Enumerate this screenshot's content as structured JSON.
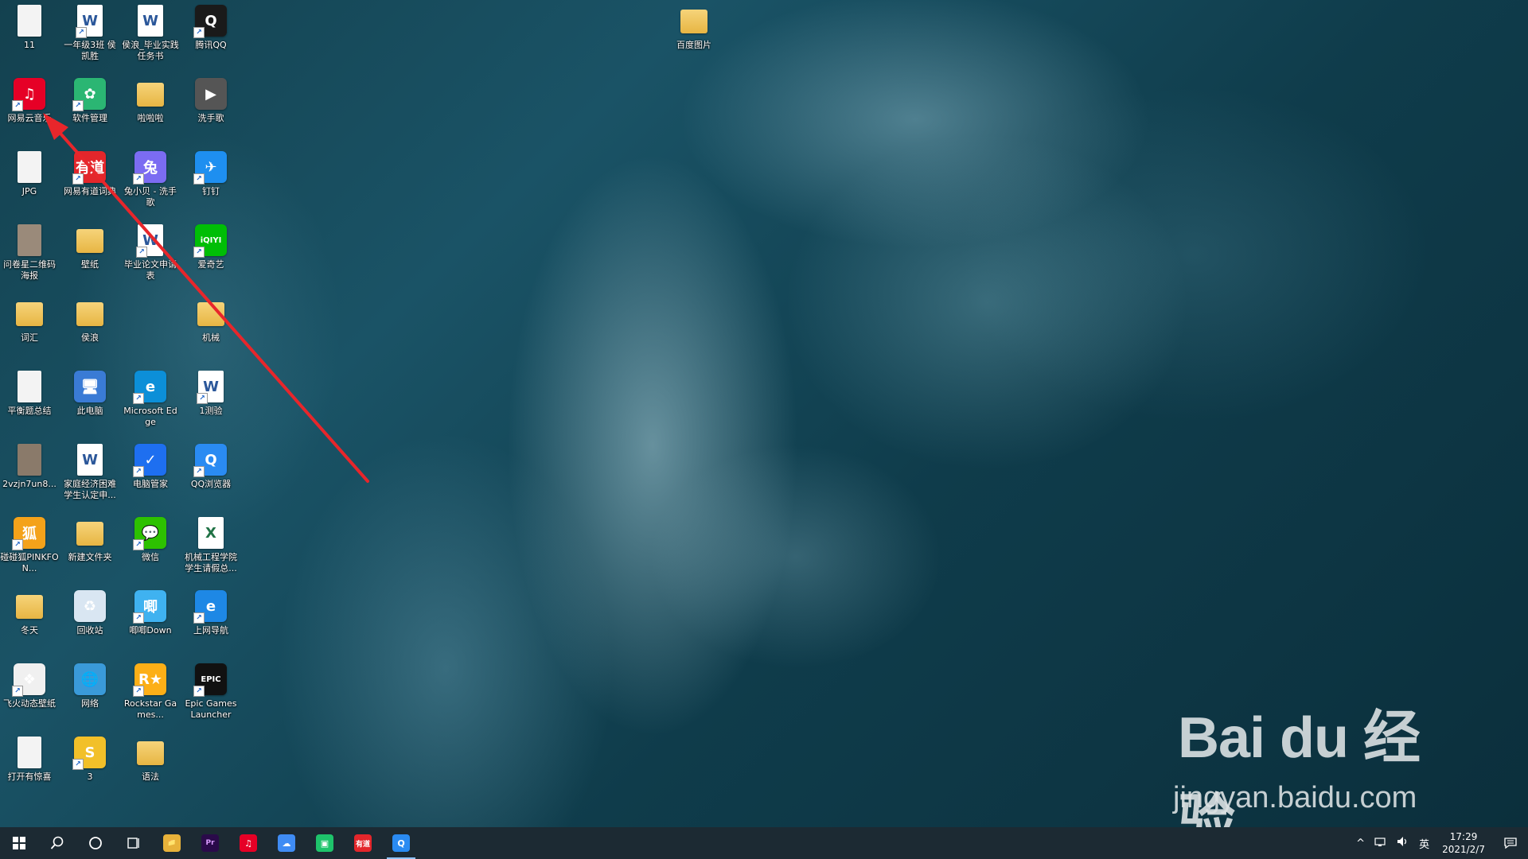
{
  "desktop": {
    "icons": [
      {
        "label": "11",
        "icon": "image-file-icon",
        "glyph": "",
        "color": "#f3f3f3",
        "shortcut": false
      },
      {
        "label": "一年级3班 侯凯胜",
        "icon": "word-doc-icon",
        "glyph": "W",
        "color": "#ffffff",
        "shortcut": true
      },
      {
        "label": "侯浪_毕业实践任务书",
        "icon": "word-doc-icon",
        "glyph": "W",
        "color": "#ffffff",
        "shortcut": false
      },
      {
        "label": "腾讯QQ",
        "icon": "qq-penguin-icon",
        "glyph": "Q",
        "color": "#1a1a1a",
        "shortcut": true
      },
      {
        "label": "网易云音乐",
        "icon": "netease-music-icon",
        "glyph": "♫",
        "color": "#e60026",
        "shortcut": true
      },
      {
        "label": "软件管理",
        "icon": "software-manager-icon",
        "glyph": "✿",
        "color": "#2bb673",
        "shortcut": true
      },
      {
        "label": "啦啦啦",
        "icon": "folder-icon",
        "glyph": "",
        "color": "#e7b543",
        "shortcut": false
      },
      {
        "label": "洗手歌",
        "icon": "video-file-icon",
        "glyph": "▶",
        "color": "#555555",
        "shortcut": false
      },
      {
        "label": "JPG",
        "icon": "image-file-icon",
        "glyph": "",
        "color": "#f3f3f3",
        "shortcut": false
      },
      {
        "label": "网易有道词典",
        "icon": "youdao-dict-icon",
        "glyph": "有道",
        "color": "#e3262b",
        "shortcut": true
      },
      {
        "label": "兔小贝 - 洗手歌",
        "icon": "tuxiaobei-icon",
        "glyph": "兔",
        "color": "#7b6cf2",
        "shortcut": true
      },
      {
        "label": "钉钉",
        "icon": "dingtalk-icon",
        "glyph": "✈",
        "color": "#1e8ff0",
        "shortcut": true
      },
      {
        "label": "问卷星二维码海报",
        "icon": "image-file-icon",
        "glyph": "",
        "color": "#9a8a7a",
        "shortcut": false
      },
      {
        "label": "壁纸",
        "icon": "folder-icon",
        "glyph": "",
        "color": "#e7b543",
        "shortcut": false
      },
      {
        "label": "毕业论文申请表",
        "icon": "word-doc-icon",
        "glyph": "W",
        "color": "#ffffff",
        "shortcut": true
      },
      {
        "label": "爱奇艺",
        "icon": "iqiyi-icon",
        "glyph": "iQIYI",
        "color": "#00be06",
        "shortcut": true
      },
      {
        "label": "词汇",
        "icon": "folder-icon",
        "glyph": "",
        "color": "#e7b543",
        "shortcut": false
      },
      {
        "label": "侯浪",
        "icon": "user-folder-icon",
        "glyph": "",
        "color": "#e7b543",
        "shortcut": false
      },
      {
        "label": "",
        "icon": "empty-slot",
        "glyph": "",
        "color": "transparent",
        "shortcut": false
      },
      {
        "label": "机械",
        "icon": "folder-icon",
        "glyph": "",
        "color": "#e7b543",
        "shortcut": false
      },
      {
        "label": "平衡题总结",
        "icon": "image-file-icon",
        "glyph": "",
        "color": "#f3f3f3",
        "shortcut": false
      },
      {
        "label": "此电脑",
        "icon": "this-pc-icon",
        "glyph": "🖥",
        "color": "#3a7bd5",
        "shortcut": false
      },
      {
        "label": "Microsoft Edge",
        "icon": "edge-browser-icon",
        "glyph": "e",
        "color": "#0c8fd8",
        "shortcut": true
      },
      {
        "label": "1测验",
        "icon": "word-doc-icon",
        "glyph": "W",
        "color": "#ffffff",
        "shortcut": true
      },
      {
        "label": "2vzjn7un8...",
        "icon": "image-file-icon",
        "glyph": "",
        "color": "#8a7a6a",
        "shortcut": false
      },
      {
        "label": "家庭经济困难学生认定申...",
        "icon": "word-doc-icon",
        "glyph": "W",
        "color": "#ffffff",
        "shortcut": false
      },
      {
        "label": "电脑管家",
        "icon": "pc-manager-shield-icon",
        "glyph": "✓",
        "color": "#1e6ff0",
        "shortcut": true
      },
      {
        "label": "QQ浏览器",
        "icon": "qq-browser-icon",
        "glyph": "Q",
        "color": "#2a8bf2",
        "shortcut": true
      },
      {
        "label": "碰碰狐PINKFON...",
        "icon": "pinkfong-icon",
        "glyph": "狐",
        "color": "#f4a21a",
        "shortcut": true
      },
      {
        "label": "新建文件夹",
        "icon": "folder-icon",
        "glyph": "",
        "color": "#e7b543",
        "shortcut": false
      },
      {
        "label": "微信",
        "icon": "wechat-icon",
        "glyph": "💬",
        "color": "#2dc100",
        "shortcut": true
      },
      {
        "label": "机械工程学院学生请假总...",
        "icon": "excel-doc-icon",
        "glyph": "X",
        "color": "#ffffff",
        "shortcut": false
      },
      {
        "label": "冬天",
        "icon": "folder-icon",
        "glyph": "",
        "color": "#e7b543",
        "shortcut": false
      },
      {
        "label": "回收站",
        "icon": "recycle-bin-icon",
        "glyph": "♻",
        "color": "#d9e6f2",
        "shortcut": false
      },
      {
        "label": "唧唧Down",
        "icon": "jijidown-icon",
        "glyph": "唧",
        "color": "#3fb2f0",
        "shortcut": true
      },
      {
        "label": "上网导航",
        "icon": "ie-browser-icon",
        "glyph": "e",
        "color": "#1e88e5",
        "shortcut": true
      },
      {
        "label": "飞火动态壁纸",
        "icon": "feihuo-wallpaper-icon",
        "glyph": "❖",
        "color": "#f0f0f0",
        "shortcut": true
      },
      {
        "label": "网络",
        "icon": "network-icon",
        "glyph": "🌐",
        "color": "#3a9ad9",
        "shortcut": false
      },
      {
        "label": "Rockstar Games...",
        "icon": "rockstar-icon",
        "glyph": "R★",
        "color": "#fcaf17",
        "shortcut": true
      },
      {
        "label": "Epic Games Launcher",
        "icon": "epic-games-icon",
        "glyph": "EPIC",
        "color": "#111111",
        "shortcut": true
      },
      {
        "label": "打开有惊喜",
        "icon": "text-file-icon",
        "glyph": "",
        "color": "#f3f3f3",
        "shortcut": false
      },
      {
        "label": "3",
        "icon": "colorful-app-icon",
        "glyph": "S",
        "color": "#f2c029",
        "shortcut": true
      },
      {
        "label": "语法",
        "icon": "folder-icon",
        "glyph": "",
        "color": "#e7b543",
        "shortcut": false
      }
    ],
    "top_icon": {
      "label": "百度图片",
      "icon": "folder-icon"
    }
  },
  "annotation": {
    "color": "#e8262b"
  },
  "watermark": {
    "logo_text": "Bai du 经验",
    "url": "jingyan.baidu.com"
  },
  "taskbar": {
    "start_icon": "windows-start-icon",
    "search_icon": "search-icon",
    "cortana_icon": "cortana-circle-icon",
    "task_view_icon": "task-view-icon",
    "apps": [
      {
        "name": "file-explorer",
        "glyph": "📁",
        "color": "#e8b23a"
      },
      {
        "name": "premiere-pro",
        "glyph": "Pr",
        "color": "#2a0a4a"
      },
      {
        "name": "netease-music",
        "glyph": "♫",
        "color": "#e60026"
      },
      {
        "name": "baidu-netdisk",
        "glyph": "☁",
        "color": "#3f8cf4"
      },
      {
        "name": "green-app",
        "glyph": "▣",
        "color": "#1ec46b"
      },
      {
        "name": "youdao-dict",
        "glyph": "有道",
        "color": "#e3262b"
      },
      {
        "name": "qq-browser",
        "glyph": "Q",
        "color": "#2a8bf2",
        "active": true
      }
    ],
    "tray": {
      "chevron": "^",
      "ime": "英",
      "time": "17:29",
      "date": "2021/2/7"
    }
  }
}
